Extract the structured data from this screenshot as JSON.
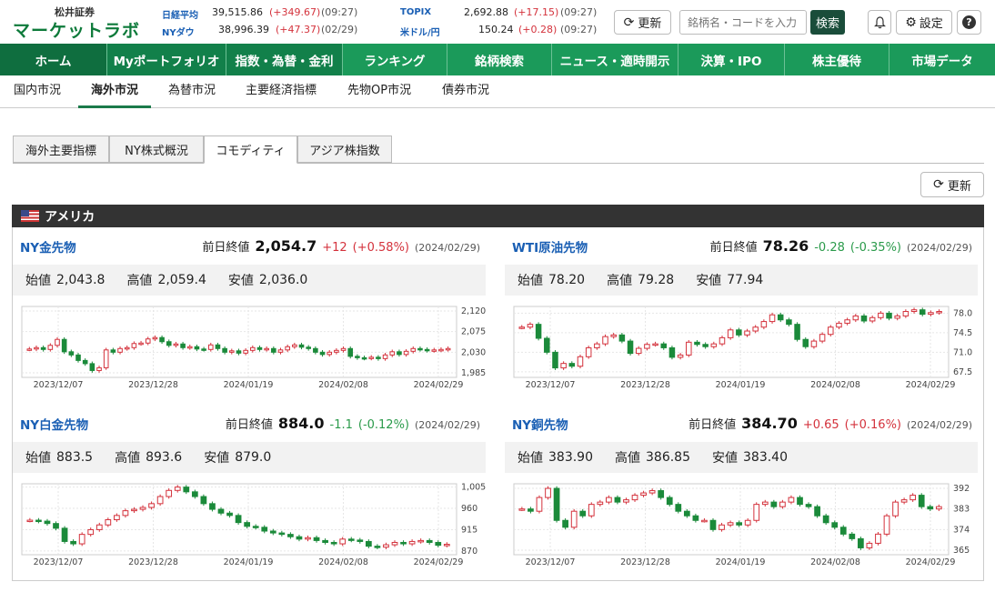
{
  "brand": {
    "company": "松井証券",
    "product": "マーケットラボ"
  },
  "tickers": [
    {
      "name": "日経平均",
      "value": "39,515.86",
      "change": "(+349.67)",
      "time": "(09:27)",
      "dir": "pos"
    },
    {
      "name": "NYダウ",
      "value": "38,996.39",
      "change": "(+47.37)",
      "time": "(02/29)",
      "dir": "pos"
    },
    {
      "name": "TOPIX",
      "value": "2,692.88",
      "change": "(+17.15)",
      "time": "(09:27)",
      "dir": "pos"
    },
    {
      "name": "米ドル/円",
      "value": "150.24",
      "change": "(+0.28)",
      "time": "(09:27)",
      "dir": "pos"
    }
  ],
  "header": {
    "refresh_label": "更新",
    "search_placeholder": "銘柄名・コードを入力",
    "search_button": "検索",
    "settings_label": "設定",
    "help_label": "?"
  },
  "nav": [
    "ホーム",
    "Myポートフォリオ",
    "指数・為替・金利",
    "ランキング",
    "銘柄検索",
    "ニュース・適時開示",
    "決算・IPO",
    "株主優待",
    "市場データ"
  ],
  "subnav": [
    "国内市況",
    "海外市況",
    "為替市況",
    "主要経済指標",
    "先物OP市況",
    "債券市況"
  ],
  "tabs": [
    "海外主要指標",
    "NY株式概況",
    "コモディティ",
    "アジア株指数"
  ],
  "refresh2_label": "更新",
  "region": "アメリカ",
  "labels": {
    "prev_close": "前日終値",
    "open": "始値",
    "high": "高値",
    "low": "安値"
  },
  "cards": [
    {
      "name": "NY金先物",
      "close": "2,054.7",
      "change": "+12",
      "pct": "(+0.58%)",
      "date": "(2024/02/29)",
      "dir": "pos",
      "open": "2,043.8",
      "high": "2,059.4",
      "low": "2,036.0",
      "yticks": [
        "2,120",
        "2,075",
        "2,030",
        "1,985"
      ],
      "ylim": [
        1975,
        2130
      ]
    },
    {
      "name": "WTI原油先物",
      "close": "78.26",
      "change": "-0.28",
      "pct": "(-0.35%)",
      "date": "(2024/02/29)",
      "dir": "neg",
      "open": "78.20",
      "high": "79.28",
      "low": "77.94",
      "yticks": [
        "78.0",
        "74.5",
        "71.0",
        "67.5"
      ],
      "ylim": [
        66.5,
        79.2
      ]
    },
    {
      "name": "NY白金先物",
      "close": "884.0",
      "change": "-1.1",
      "pct": "(-0.12%)",
      "date": "(2024/02/29)",
      "dir": "neg",
      "open": "883.5",
      "high": "893.6",
      "low": "879.0",
      "yticks": [
        "1,005",
        "960",
        "915",
        "870"
      ],
      "ylim": [
        862,
        1012
      ]
    },
    {
      "name": "NY銅先物",
      "close": "384.70",
      "change": "+0.65",
      "pct": "(+0.16%)",
      "date": "(2024/02/29)",
      "dir": "pos",
      "open": "383.90",
      "high": "386.85",
      "low": "383.40",
      "yticks": [
        "392",
        "383",
        "374",
        "365"
      ],
      "ylim": [
        363,
        394
      ]
    }
  ],
  "chart_data": [
    {
      "type": "line",
      "title": "NY金先物",
      "xlabels": [
        "2023/12/07",
        "2023/12/28",
        "2024/01/19",
        "2024/02/08",
        "2024/02/29"
      ],
      "ylim": [
        1975,
        2130
      ],
      "values": [
        2037,
        2040,
        2036,
        2045,
        2058,
        2031,
        2024,
        2012,
        2005,
        1990,
        1996,
        2035,
        2030,
        2038,
        2040,
        2049,
        2050,
        2059,
        2062,
        2053,
        2045,
        2048,
        2040,
        2042,
        2037,
        2036,
        2046,
        2038,
        2030,
        2033,
        2028,
        2034,
        2040,
        2036,
        2038,
        2030,
        2035,
        2042,
        2046,
        2041,
        2038,
        2030,
        2025,
        2030,
        2034,
        2038,
        2021,
        2018,
        2017,
        2019,
        2016,
        2024,
        2031,
        2025,
        2032,
        2038,
        2036,
        2034,
        2035,
        2036,
        2038
      ]
    },
    {
      "type": "line",
      "title": "WTI原油先物",
      "xlabels": [
        "2023/12/07",
        "2023/12/28",
        "2024/01/19",
        "2024/02/08",
        "2024/02/29"
      ],
      "ylim": [
        66.5,
        79.2
      ],
      "values": [
        75.5,
        76.0,
        73.5,
        71.0,
        68.2,
        69.0,
        68.5,
        70.2,
        71.8,
        72.5,
        73.8,
        74.1,
        73.0,
        70.8,
        71.7,
        72.4,
        72.5,
        71.8,
        70.1,
        70.5,
        72.8,
        72.4,
        72.0,
        72.5,
        73.6,
        75.0,
        74.1,
        74.8,
        75.5,
        76.5,
        77.7,
        76.8,
        76.0,
        73.3,
        72.0,
        73.0,
        74.2,
        75.5,
        76.2,
        76.8,
        77.5,
        76.6,
        77.2,
        78.0,
        77.1,
        77.5,
        78.3,
        78.6,
        77.8,
        78.1,
        78.3
      ]
    },
    {
      "type": "line",
      "title": "NY白金先物",
      "xlabels": [
        "2023/12/07",
        "2023/12/28",
        "2024/01/19",
        "2024/02/08",
        "2024/02/29"
      ],
      "ylim": [
        862,
        1012
      ],
      "values": [
        935,
        933,
        928,
        918,
        890,
        885,
        905,
        915,
        925,
        936,
        945,
        955,
        958,
        962,
        970,
        985,
        998,
        1005,
        995,
        985,
        970,
        958,
        950,
        945,
        930,
        922,
        920,
        912,
        908,
        905,
        900,
        895,
        898,
        892,
        888,
        885,
        895,
        893,
        890,
        880,
        878,
        883,
        888,
        885,
        890,
        892,
        888,
        882,
        884
      ]
    },
    {
      "type": "line",
      "title": "NY銅先物",
      "xlabels": [
        "2023/12/07",
        "2023/12/28",
        "2024/01/19",
        "2024/02/08",
        "2024/02/29"
      ],
      "ylim": [
        363,
        394
      ],
      "values": [
        383,
        382,
        388,
        392,
        378,
        375,
        382,
        380,
        385,
        386,
        388,
        386,
        387,
        389,
        390,
        391,
        388,
        385,
        382,
        380,
        378,
        378,
        374,
        376,
        377,
        376,
        378,
        385,
        386,
        384,
        386,
        388,
        385,
        384,
        380,
        377,
        375,
        372,
        370,
        366,
        368,
        372,
        380,
        386,
        387,
        389,
        384,
        383,
        384
      ]
    }
  ]
}
